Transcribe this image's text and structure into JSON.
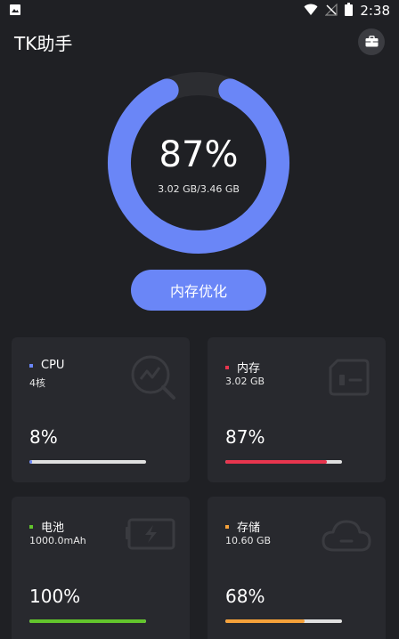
{
  "status_bar": {
    "time": "2:38",
    "icons": [
      "image-icon",
      "wifi-icon",
      "no-signal-icon",
      "battery-icon"
    ]
  },
  "app_bar": {
    "title": "TK助手",
    "action_icon": "briefcase-icon"
  },
  "memory_gauge": {
    "percent_label": "87%",
    "usage_label": "3.02 GB/3.46 GB",
    "fraction": 0.87,
    "colors": {
      "arc": "#6a86f7",
      "track": "#2c2d31"
    }
  },
  "optimize_button": {
    "label": "内存优化",
    "color": "#6a86f7"
  },
  "cards": [
    {
      "title": "CPU",
      "sub": "4核",
      "value": "8%",
      "fraction": 0.02,
      "color": "#6a86f7",
      "icon": "chart-search-icon"
    },
    {
      "title": "内存",
      "sub": "3.02 GB",
      "value": "87%",
      "fraction": 0.87,
      "color": "#e8354e",
      "icon": "sd-card-icon"
    },
    {
      "title": "电池",
      "sub": "1000.0mAh",
      "value": "100%",
      "fraction": 1.0,
      "color": "#62c42c",
      "icon": "battery-charging-icon"
    },
    {
      "title": "存储",
      "sub": "10.60 GB",
      "value": "68%",
      "fraction": 0.68,
      "color": "#f5a13a",
      "icon": "cloud-icon"
    }
  ]
}
